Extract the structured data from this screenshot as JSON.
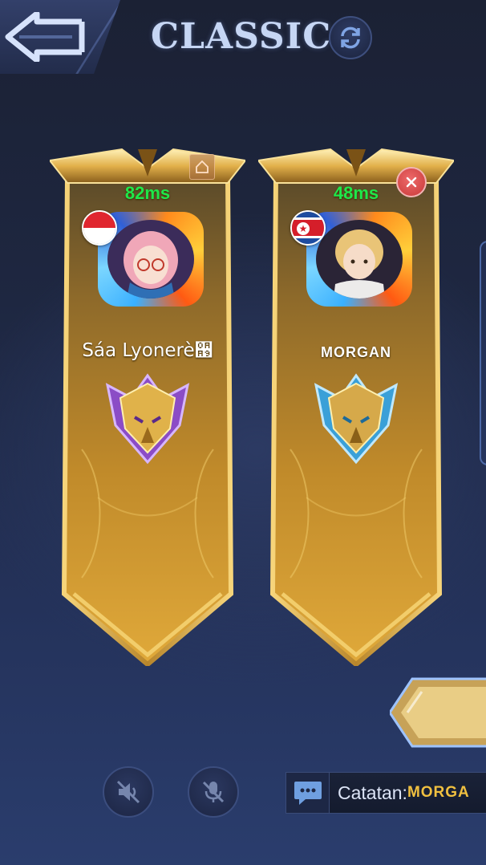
{
  "header": {
    "title": "CLASSIC",
    "back_icon": "back-arrow-icon",
    "refresh_icon": "refresh-icon"
  },
  "players": [
    {
      "ping": "82ms",
      "name": "Sáa Lyonerè઩",
      "flag": "indonesia-flag-icon",
      "corner_icon": "home-icon",
      "rank": "mythic-purple-emblem"
    },
    {
      "ping": "48ms",
      "name": "MORGAN",
      "flag": "north-korea-flag-icon",
      "corner_icon": "close-icon",
      "rank": "mythic-blue-emblem"
    }
  ],
  "bottom": {
    "speaker_icon": "speaker-muted-icon",
    "mic_icon": "mic-muted-icon",
    "chat_icon": "chat-icon",
    "notes_label": "Catatan:",
    "notes_value": "MORGA"
  },
  "colors": {
    "ping": "#1ee84a",
    "gold": "#d8a83a",
    "title": "#c6d6f4",
    "notes_value": "#f0c040"
  }
}
